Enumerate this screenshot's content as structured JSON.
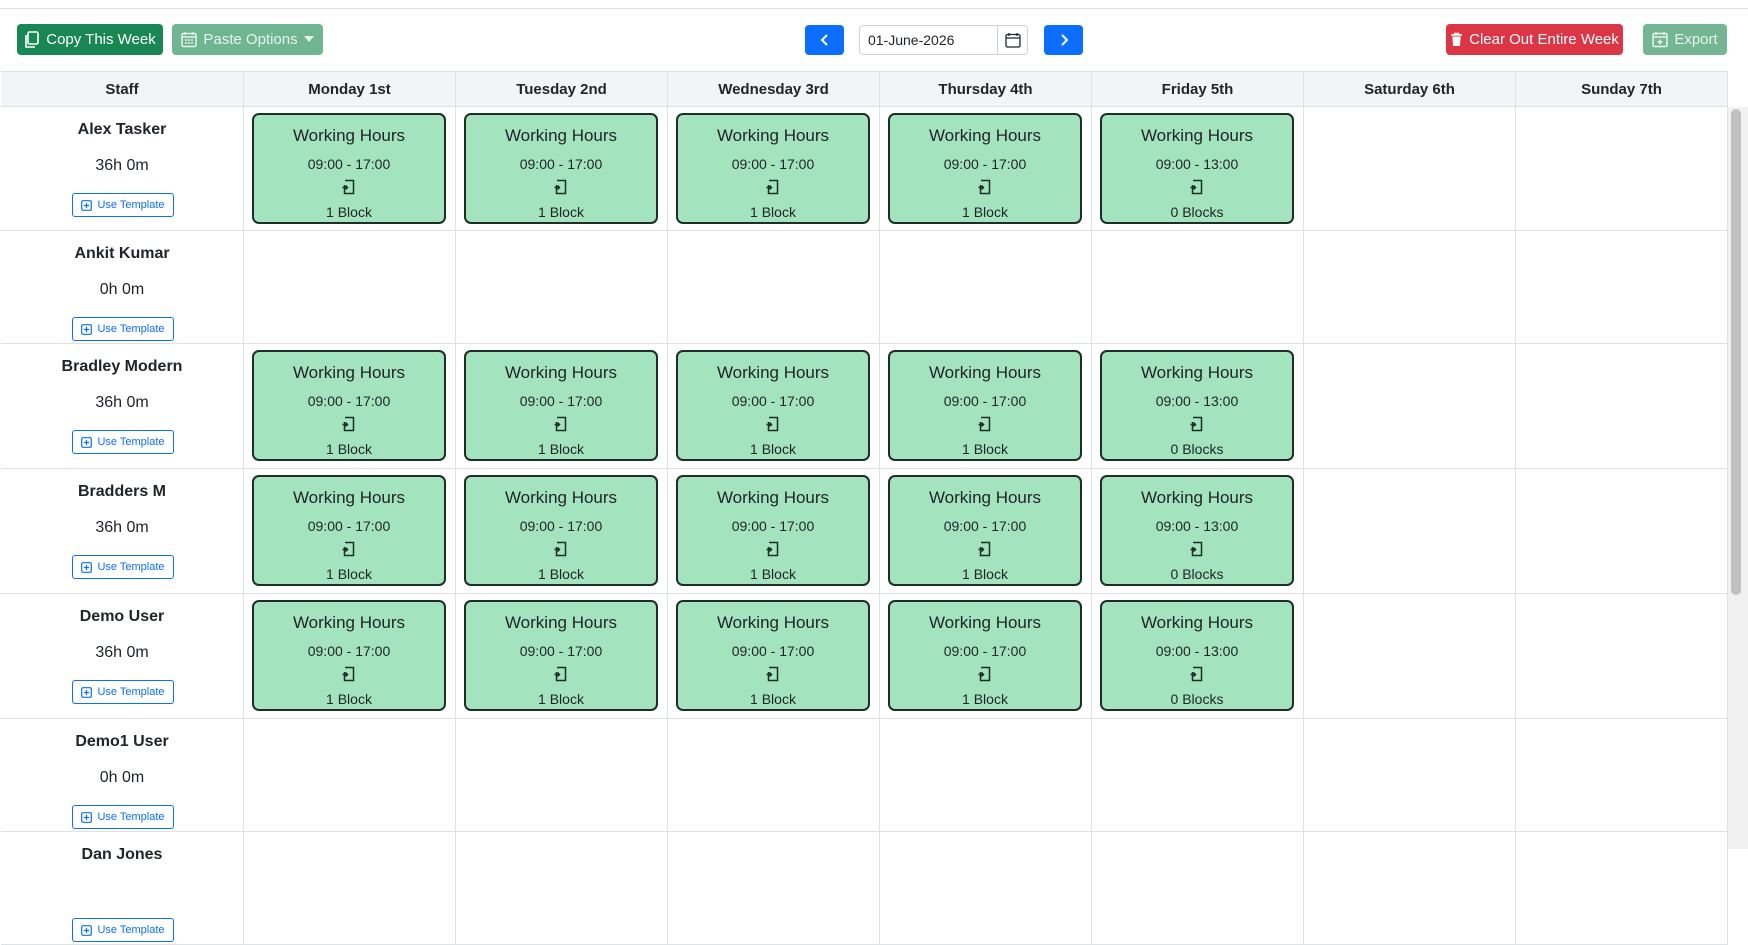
{
  "toolbar": {
    "copy_label": "Copy This Week",
    "paste_label": "Paste Options",
    "date_value": "01-June-2026",
    "clear_label": "Clear Out Entire Week",
    "export_label": "Export"
  },
  "columns": [
    "Staff",
    "Monday 1st",
    "Tuesday 2nd",
    "Wednesday 3rd",
    "Thursday 4th",
    "Friday 5th",
    "Saturday 6th",
    "Sunday 7th"
  ],
  "use_template_label": "Use Template",
  "shift_title": "Working Hours",
  "staff": [
    {
      "name": "Alex Tasker",
      "hours": "36h 0m",
      "shifts": [
        {
          "time": "09:00 - 17:00",
          "blocks": "1 Block"
        },
        {
          "time": "09:00 - 17:00",
          "blocks": "1 Block"
        },
        {
          "time": "09:00 - 17:00",
          "blocks": "1 Block"
        },
        {
          "time": "09:00 - 17:00",
          "blocks": "1 Block"
        },
        {
          "time": "09:00 - 13:00",
          "blocks": "0 Blocks"
        },
        null,
        null
      ]
    },
    {
      "name": "Ankit Kumar",
      "hours": "0h 0m",
      "shifts": [
        null,
        null,
        null,
        null,
        null,
        null,
        null
      ]
    },
    {
      "name": "Bradley Modern",
      "hours": "36h 0m",
      "shifts": [
        {
          "time": "09:00 - 17:00",
          "blocks": "1 Block"
        },
        {
          "time": "09:00 - 17:00",
          "blocks": "1 Block"
        },
        {
          "time": "09:00 - 17:00",
          "blocks": "1 Block"
        },
        {
          "time": "09:00 - 17:00",
          "blocks": "1 Block"
        },
        {
          "time": "09:00 - 13:00",
          "blocks": "0 Blocks"
        },
        null,
        null
      ]
    },
    {
      "name": "Bradders M",
      "hours": "36h 0m",
      "shifts": [
        {
          "time": "09:00 - 17:00",
          "blocks": "1 Block"
        },
        {
          "time": "09:00 - 17:00",
          "blocks": "1 Block"
        },
        {
          "time": "09:00 - 17:00",
          "blocks": "1 Block"
        },
        {
          "time": "09:00 - 17:00",
          "blocks": "1 Block"
        },
        {
          "time": "09:00 - 13:00",
          "blocks": "0 Blocks"
        },
        null,
        null
      ]
    },
    {
      "name": "Demo User",
      "hours": "36h 0m",
      "shifts": [
        {
          "time": "09:00 - 17:00",
          "blocks": "1 Block"
        },
        {
          "time": "09:00 - 17:00",
          "blocks": "1 Block"
        },
        {
          "time": "09:00 - 17:00",
          "blocks": "1 Block"
        },
        {
          "time": "09:00 - 17:00",
          "blocks": "1 Block"
        },
        {
          "time": "09:00 - 13:00",
          "blocks": "0 Blocks"
        },
        null,
        null
      ]
    },
    {
      "name": "Demo1 User",
      "hours": "0h 0m",
      "shifts": [
        null,
        null,
        null,
        null,
        null,
        null,
        null
      ]
    },
    {
      "name": "Dan Jones",
      "hours": "",
      "shifts": [
        null,
        null,
        null,
        null,
        null,
        null,
        null
      ]
    }
  ]
}
